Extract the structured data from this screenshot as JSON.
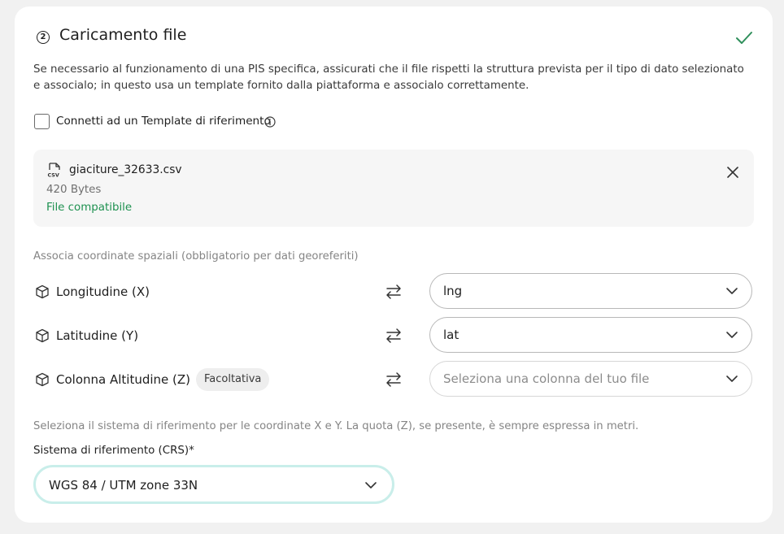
{
  "step": {
    "number": "2",
    "title": "Caricamento file",
    "status_icon": "check-icon"
  },
  "description": "Se necessario al funzionamento di una PIS specifica, assicurati che il file rispetti la struttura prevista per il tipo di dato selezionato e associalo; in questo usa un template fornito dalla piattaforma e associalo correttamente.",
  "template_checkbox": {
    "label": "Connetti ad un Template di riferimento",
    "checked": false,
    "info_icon": "info-icon"
  },
  "file": {
    "icon": "csv-file-icon",
    "name": "giaciture_32633.csv",
    "size": "420 Bytes",
    "status": "File compatibile",
    "close_icon": "close-icon"
  },
  "coordinates": {
    "section_label": "Associa coordinate spaziali (obbligatorio per dati georeferiti)",
    "rows": [
      {
        "label": "Longitudine (X)",
        "badge": "",
        "value": "lng",
        "placeholder": false
      },
      {
        "label": "Latitudine (Y)",
        "badge": "",
        "value": "lat",
        "placeholder": false
      },
      {
        "label": "Colonna Altitudine (Z)",
        "badge": "Facoltativa",
        "value": "Seleziona una colonna del tuo file",
        "placeholder": true
      }
    ]
  },
  "crs": {
    "description": "Seleziona il sistema di riferimento per le coordinate X e Y. La quota (Z), se presente, è sempre espressa in metri.",
    "label": "Sistema di riferimento (CRS)*",
    "value": "WGS 84 / UTM zone 33N"
  },
  "colors": {
    "success": "#1e9150",
    "check": "#2f8f5b",
    "focus_ring": "#c9eeea"
  }
}
